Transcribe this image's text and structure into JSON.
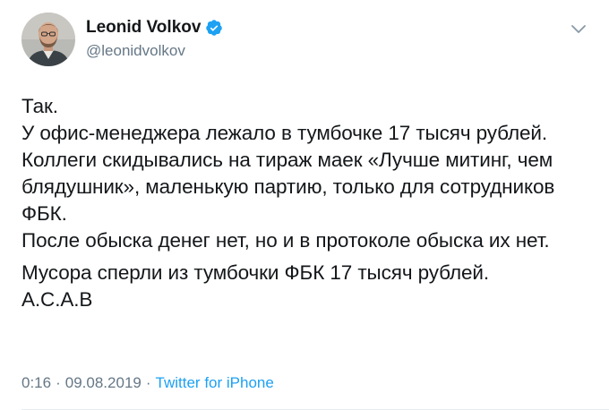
{
  "tweet": {
    "author": {
      "name": "Leonid Volkov",
      "handle": "@leonidvolkov",
      "verified_icon": "verified-badge-icon",
      "accent_color": "#1da1f2"
    },
    "menu_icon": "chevron-down-icon",
    "paragraphs": [
      "Так.",
      "У офис-менеджера лежало в тумбочке 17 тысяч рублей.",
      "Коллеги скидывались на тираж маек «Лучше митинг, чем блядушник», маленькую партию, только для сотрудников ФБК.",
      "После обыска денег нет, но и в протоколе обыска их нет.",
      "Мусора сперли из тумбочки ФБК 17 тысяч рублей.",
      "А.С.А.В"
    ],
    "time": "0:16",
    "date": "09.08.2019",
    "separator": "·",
    "source": "Twitter for iPhone"
  }
}
